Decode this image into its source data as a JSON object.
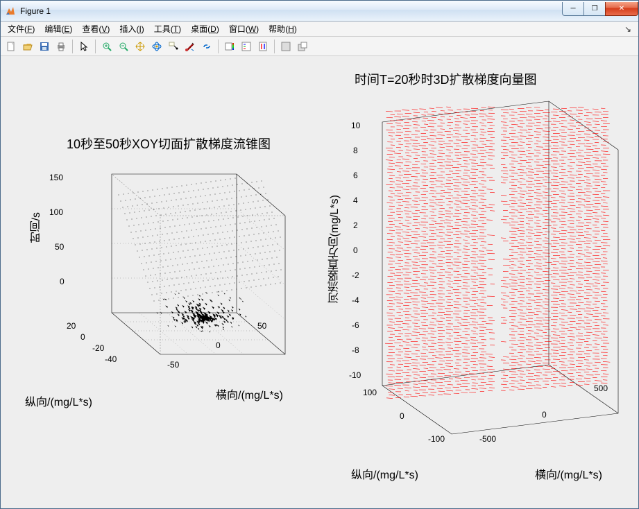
{
  "window": {
    "title": "Figure 1",
    "min_glyph": "─",
    "max_glyph": "❐",
    "close_glyph": "✕",
    "menu_right_glyph": "↘"
  },
  "menu": {
    "items": [
      {
        "label": "文件",
        "accel": "F"
      },
      {
        "label": "编辑",
        "accel": "E"
      },
      {
        "label": "查看",
        "accel": "V"
      },
      {
        "label": "插入",
        "accel": "I"
      },
      {
        "label": "工具",
        "accel": "T"
      },
      {
        "label": "桌面",
        "accel": "D"
      },
      {
        "label": "窗口",
        "accel": "W"
      },
      {
        "label": "帮助",
        "accel": "H"
      }
    ]
  },
  "toolbar": {
    "icons": [
      "new-file",
      "open-file",
      "save-file",
      "print",
      "|",
      "pointer",
      "|",
      "zoom-in",
      "zoom-out",
      "pan",
      "rotate3d",
      "data-cursor",
      "brush",
      "link",
      "|",
      "colorbar",
      "legend",
      "insert-colorbar",
      "|",
      "dock",
      "undock"
    ]
  },
  "chart_data": [
    {
      "type": "cone3d",
      "title": "10秒至50秒XOY切面扩散梯度流锥图",
      "xlabel": "横向/(mg/L*s)",
      "ylabel": "纵向/(mg/L*s)",
      "zlabel": "时间/s",
      "x_range": [
        -50,
        50
      ],
      "y_range": [
        -50,
        50
      ],
      "z_range": [
        0,
        150
      ],
      "x_ticks": [
        -50,
        0,
        50
      ],
      "y_ticks": [
        -40,
        -20,
        0,
        20
      ],
      "z_ticks": [
        0,
        50,
        100,
        150
      ],
      "description": "Cone plot of diffusion gradient on XOY slices from t=10s to t=50s; dense black cones concentrated near origin at low z, spreading outward with increasing time.",
      "color": "#000000"
    },
    {
      "type": "quiver3d",
      "title": "时间T=20秒时3D扩散梯度向量图",
      "xlabel": "横向/(mg/L*s)",
      "ylabel": "纵向/(mg/L*s)",
      "zlabel": "河流竖直方向(mg/L*s)",
      "x_range": [
        -500,
        500
      ],
      "y_range": [
        -100,
        100
      ],
      "z_range": [
        -10,
        10
      ],
      "x_ticks": [
        -500,
        0,
        500
      ],
      "y_ticks": [
        -100,
        0,
        100
      ],
      "z_ticks": [
        -10,
        -8,
        -6,
        -4,
        -2,
        0,
        2,
        4,
        6,
        8,
        10
      ],
      "description": "Dense red 3D vector field (quiver) at T=20s filling a rectangular volume; vectors radiate outward, strongest along central column, forming a solid red box with slight vertical void near center.",
      "color": "#ff0000"
    }
  ]
}
